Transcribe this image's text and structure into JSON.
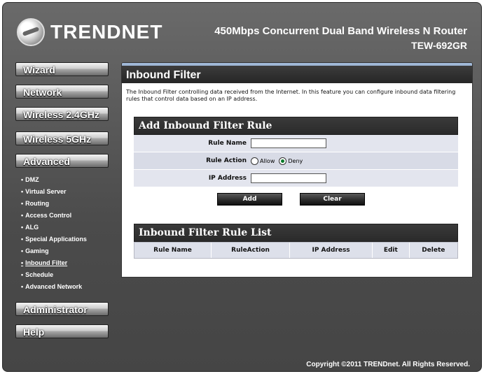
{
  "brand": {
    "name": "TRENDnet",
    "logo_text": "TRENDNET"
  },
  "product": {
    "title": "450Mbps Concurrent Dual Band Wireless N Router",
    "model": "TEW-692GR"
  },
  "menu": {
    "wizard": "Wizard",
    "network": "Network",
    "wireless24": "Wireless 2.4GHz",
    "wireless5": "Wireless 5GHz",
    "advanced": "Advanced",
    "administrator": "Administrator",
    "help": "Help",
    "advanced_items": [
      "DMZ",
      "Virtual Server",
      "Routing",
      "Access Control",
      "ALG",
      "Special Applications",
      "Gaming",
      "Inbound Filter",
      "Schedule",
      "Advanced Network"
    ],
    "active_item": "Inbound Filter"
  },
  "page": {
    "title": "Inbound Filter",
    "description": "The Inbound Filter controlling data received from the Internet. In this feature you can configure inbound data filtering rules that control data based on an IP address."
  },
  "form": {
    "heading": "Add Inbound Filter Rule",
    "rule_name_label": "Rule Name",
    "rule_name_value": "",
    "rule_action_label": "Rule Action",
    "allow_label": "Allow",
    "deny_label": "Deny",
    "selected_action": "Deny",
    "ip_label": "IP Address",
    "ip_value": "",
    "add_button": "Add",
    "clear_button": "Clear"
  },
  "rule_list": {
    "heading": "Inbound Filter Rule List",
    "columns": [
      "Rule Name",
      "RuleAction",
      "IP Address",
      "Edit",
      "Delete"
    ],
    "rows": []
  },
  "footer": {
    "copyright": "Copyright ©2011 TRENDnet. All Rights Reserved."
  }
}
